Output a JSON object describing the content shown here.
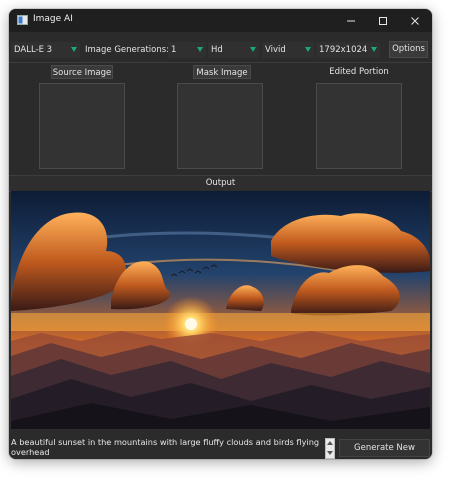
{
  "window": {
    "title": "Image AI",
    "icon": "app-window-icon",
    "controls": [
      "minimize-icon",
      "maximize-icon",
      "close-icon"
    ]
  },
  "toolbar": {
    "model": "DALL-E 3",
    "generations_label": "Image Generations:",
    "generations_value": "1",
    "quality": "Hd",
    "style": "Vivid",
    "size": "1792x1024",
    "options_label": "Options",
    "dropdown_arrow_color": "#1aa87a"
  },
  "panels": {
    "source_label": "Source Image",
    "mask_label": "Mask Image",
    "edited_label": "Edited Portion"
  },
  "output": {
    "label": "Output",
    "image_description_icon": "generated-sunset-image"
  },
  "bottom": {
    "prompt_text": "A beautiful sunset in the mountains with large fluffy clouds and birds flying overhead",
    "generate_label": "Generate New Image"
  }
}
